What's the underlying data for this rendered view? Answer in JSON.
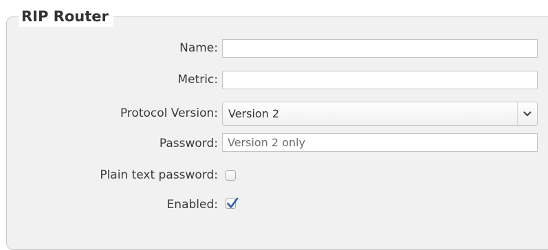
{
  "panel": {
    "title": "RIP Router"
  },
  "form": {
    "name": {
      "label": "Name:",
      "value": ""
    },
    "metric": {
      "label": "Metric:",
      "value": ""
    },
    "protocol_version": {
      "label": "Protocol Version:",
      "selected": "Version 2"
    },
    "password": {
      "label": "Password:",
      "placeholder": "Version 2 only"
    },
    "plain_text_password": {
      "label": "Plain text password:",
      "checked": false
    },
    "enabled": {
      "label": "Enabled:",
      "checked": true
    }
  },
  "colors": {
    "checkmark": "#2a5ea8",
    "panel_background": "#f1f1f1"
  },
  "icons": {
    "select_arrow": "chevron-down-icon",
    "check": "checkmark-icon"
  }
}
